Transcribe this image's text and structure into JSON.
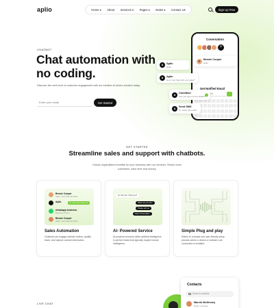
{
  "nav": {
    "logo": "aplio",
    "menu": [
      "Home ▾",
      "About",
      "Services ▾",
      "Pages ▾",
      "Notes ▾",
      "Contact Us"
    ],
    "signup": "Sign Up Free"
  },
  "hero": {
    "tag": "CHATBOT",
    "title": "Chat automation with no coding.",
    "subtitle": "Discover the next level of customer engagement with our intuitive AI-driven solution today.",
    "email_placeholder": "Enter your email",
    "cta": "Get Started"
  },
  "phone": {
    "title": "Coversation",
    "notify_title": "Get Notified Email",
    "notify_placeholder": "type your text"
  },
  "floating": {
    "bessie": {
      "name": "Bessie Cooper",
      "sub": "Hello"
    },
    "aplio1": {
      "name": "Aplio",
      "sub": "Hello"
    },
    "aplio2": {
      "name": "Aplio",
      "sub": "How I can help with you today?"
    },
    "condition": {
      "name": "Condition",
      "sub": "Can you give me the details?"
    },
    "sendsms": {
      "name": "Send SMS",
      "sub": "To match type Hello"
    }
  },
  "section2": {
    "tag": "GET STARTED",
    "title": "Streamline sales and support with chatbots.",
    "subtitle": "Unlock unparalleled benefits for your business with our services. Reach more customers, save time and money."
  },
  "features": [
    {
      "title": "Sales Automation",
      "desc": "Chatbots can engage website visitors, qualify leads, and capture contact information.",
      "rows": [
        {
          "name": "Bessie Cooper",
          "sub": "Hello, I need help with sales",
          "pill": ""
        },
        {
          "name": "Aplio",
          "sub": "",
          "pill": "Hi, how may I help you?"
        },
        {
          "name": "whatsapp business",
          "sub": "Business account",
          "pill": ""
        },
        {
          "name": "Bessie Cooper",
          "sub": "Hello, I need help with sales",
          "pill": ""
        }
      ]
    },
    {
      "title": "AI- Powered Service",
      "desc": "AI-powered services utilize artificial intelligence to perform tasks that typically require human intelligence.",
      "bubbles": [
        "Hi, how can I help you?",
        "What can you do?",
        "Please tell me",
        "Start conversation"
      ]
    },
    {
      "title": "Simple Plug and play",
      "desc": "Refers to a simple and user-friendly setup process where a device or software can connected or installed."
    }
  ],
  "contacts": {
    "title": "Contacts",
    "search_placeholder": "Search contacts",
    "item_name": "Marvin McKinney",
    "item_sub": "Reply message"
  },
  "live": {
    "tag": "LIVE CHAT"
  },
  "colors": {
    "accent": "#7ccd3a",
    "dark": "#111111",
    "glow": "#e2f5c9"
  }
}
